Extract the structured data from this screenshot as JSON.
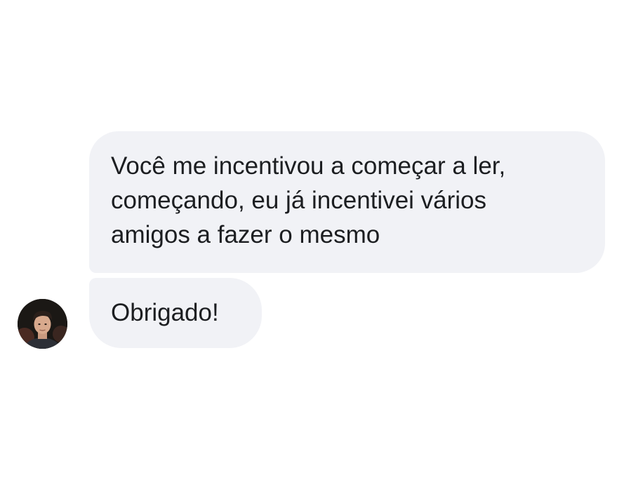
{
  "messages": [
    {
      "sender": "other",
      "text_lines": [
        "Você me incentivou a começar a ler,",
        "começando, eu já incentivei vários",
        "amigos a fazer o mesmo"
      ]
    },
    {
      "sender": "other",
      "text_lines": [
        "Obrigado!"
      ]
    }
  ],
  "colors": {
    "bubble_background": "#f1f2f6",
    "text": "#1c1e21",
    "page_background": "#ffffff"
  },
  "icons": {
    "avatar": "user-avatar-photo"
  }
}
